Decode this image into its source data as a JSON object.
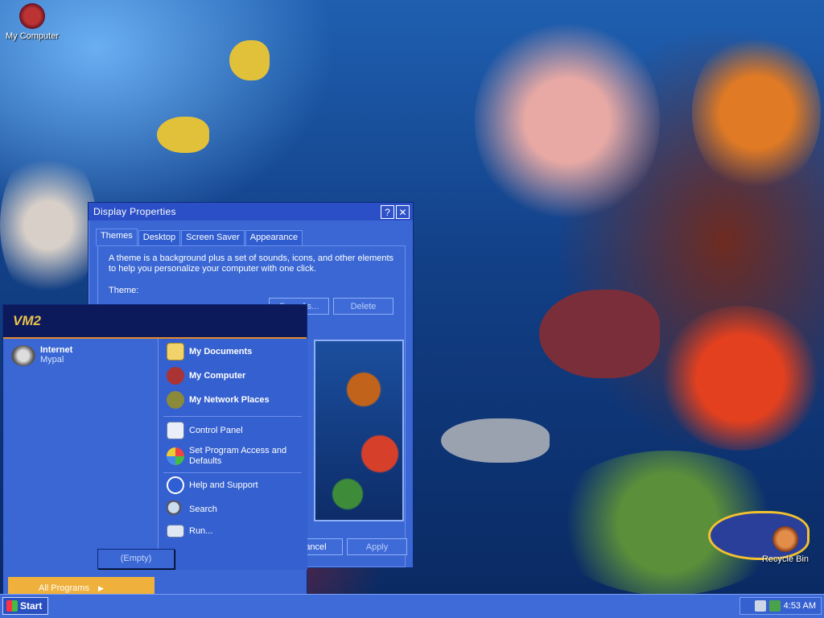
{
  "desktop": {
    "icons": [
      {
        "label": "My Computer"
      },
      {
        "label": "Recycle Bin"
      }
    ]
  },
  "display_window": {
    "title": "Display Properties",
    "help_button": "?",
    "close_button": "✕",
    "tabs": [
      {
        "label": "Themes",
        "active": true
      },
      {
        "label": "Desktop"
      },
      {
        "label": "Screen Saver"
      },
      {
        "label": "Appearance"
      }
    ],
    "description": "A theme is a background plus a set of sounds, icons, and other elements to help you personalize your computer with one click.",
    "theme_label": "Theme:",
    "save_as_button": "Save As...",
    "delete_button": "Delete",
    "cancel_button": "Cancel",
    "apply_button": "Apply"
  },
  "start_menu": {
    "header": "VM2",
    "pinned": [
      {
        "title": "Internet",
        "subtitle": "Mypal",
        "icon": "raccoon-icon"
      }
    ],
    "right_items": [
      {
        "label": "My Documents",
        "bold": true,
        "icon": "folder-icon"
      },
      {
        "label": "My Computer",
        "bold": true,
        "icon": "computer-icon"
      },
      {
        "label": "My Network Places",
        "bold": true,
        "icon": "network-icon"
      },
      {
        "label": "Control Panel",
        "bold": false,
        "icon": "control-panel-icon"
      },
      {
        "label": "Set Program Access and Defaults",
        "bold": false,
        "icon": "program-access-icon"
      },
      {
        "label": "Help and Support",
        "bold": false,
        "icon": "help-icon"
      },
      {
        "label": "Search",
        "bold": false,
        "icon": "search-icon"
      },
      {
        "label": "Run...",
        "bold": false,
        "icon": "run-icon"
      }
    ],
    "all_programs": "All Programs",
    "all_programs_arrow": "▶",
    "submenu_empty": "(Empty)"
  },
  "taskbar": {
    "start_label": "Start",
    "clock": "4:53 AM"
  },
  "colors": {
    "window_blue": "#3a67d4",
    "start_header": "#0c1a5c",
    "all_programs_orange": "#f0b13c"
  }
}
